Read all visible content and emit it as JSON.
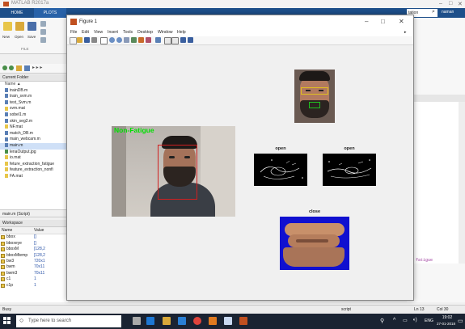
{
  "matlab": {
    "title": "MATLAB R2017a",
    "tabs": [
      "HOME",
      "PLOTS"
    ],
    "ribbon": {
      "new_label": "New",
      "open_label": "Open",
      "save_label": "Save",
      "file_group": "FILE"
    },
    "search_partial": "tation",
    "user": "naman",
    "current_folder_header": "Current Folder",
    "name_col": "Name",
    "files": [
      "trainDB.m",
      "train_svm.m",
      "test_Svm.m",
      "svm.mat",
      "sobel1.m",
      "skin_seg2.m",
      "NF.mat",
      "match_DB.m",
      "main_webcam.m",
      "main.m",
      "lenaOutput.jpg",
      "io.mat",
      "feture_extraction_fatigue",
      "feature_extraction_nonfi",
      "FA.mat"
    ],
    "selected_file": "main.m",
    "details": "main.m (Script)",
    "workspace_header": "Workspace",
    "ws_cols": [
      "Name",
      "Value"
    ],
    "workspace": [
      {
        "name": "bbox",
        "value": "[]"
      },
      {
        "name": "bboxeye",
        "value": "[]"
      },
      {
        "name": "bboxM",
        "value": "[128,2"
      },
      {
        "name": "bboxMtemp",
        "value": "[128,2"
      },
      {
        "name": "bw3",
        "value": "720x1"
      },
      {
        "name": "bwm",
        "value": "70x11"
      },
      {
        "name": "bwm3",
        "value": "70x11"
      },
      {
        "name": "c1",
        "value": "1"
      },
      {
        "name": "c1p",
        "value": "1"
      }
    ],
    "prompt": "fx",
    "editor_fragment": "ay fatigue",
    "status_busy": "Busy",
    "status_script": "script",
    "status_ln": "Ln 13",
    "status_col": "Col 30"
  },
  "figure": {
    "title": "Figure 1",
    "menu": [
      "File",
      "Edit",
      "View",
      "Insert",
      "Tools",
      "Desktop",
      "Window",
      "Help"
    ],
    "label_main": "Non-Fatigue",
    "label_open1": "open",
    "label_open2": "open",
    "label_close": "close"
  },
  "taskbar": {
    "search_placeholder": "Type here to search",
    "time": "19:02",
    "date": "27-01-2018",
    "lang": "ENG"
  },
  "colors": {
    "matlab_blue": "#1d4f8a",
    "label_green": "#00e000",
    "bbox_red": "#d02020",
    "close_blue": "#1010d0",
    "taskbar": "#1a2332"
  }
}
